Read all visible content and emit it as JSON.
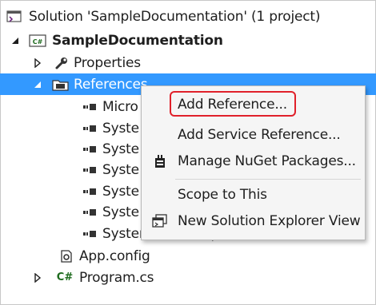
{
  "tree": {
    "solution_label": "Solution 'SampleDocumentation' (1 project)",
    "project_label": "SampleDocumentation",
    "properties_label": "Properties",
    "references_label": "References",
    "ref_items": [
      "Micro",
      "Syste",
      "Syste",
      "Syste",
      "Syste",
      "Syste",
      "System.Xml.Linq"
    ],
    "app_config_label": "App.config",
    "program_label": "Program.cs",
    "cs_badge": "C#"
  },
  "context_menu": {
    "add_reference": "Add Reference...",
    "add_service_reference": "Add Service Reference...",
    "manage_nuget": "Manage NuGet Packages...",
    "scope_to_this": "Scope to This",
    "new_explorer_view": "New Solution Explorer View"
  },
  "colors": {
    "selection": "#3399ff",
    "highlight_ring": "#e0202a",
    "menu_background": "#f5f5f5"
  },
  "icons": {
    "solution": "solution-icon",
    "project": "csharp-project-icon",
    "properties": "wrench-icon",
    "references": "folder-icon",
    "assembly": "assembly-reference-icon",
    "config": "config-file-icon",
    "csharp_file": "csharp-file-icon",
    "nuget": "nuget-icon",
    "new_view": "new-view-icon"
  }
}
